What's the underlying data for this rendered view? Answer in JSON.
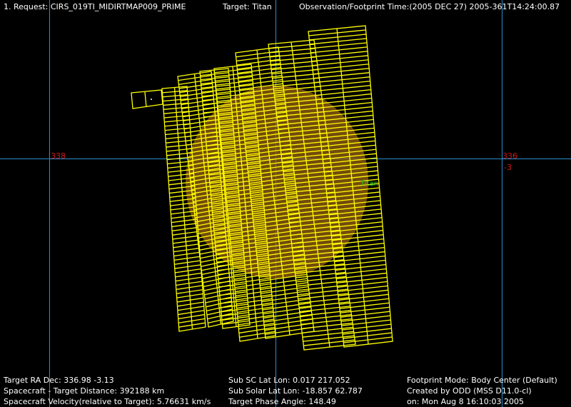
{
  "header": {
    "request": "1. Request: CIRS_019TI_MIDIRTMAP009_PRIME",
    "target": "Target: Titan",
    "observation_time": "Observation/Footprint Time:(2005 DEC 27) 2005-361T14:24:00.87"
  },
  "axis_labels": {
    "left_ra": "338",
    "right_ra": "336",
    "right_dec": "-3",
    "planet_label": "Titan"
  },
  "footer": {
    "target_ra_dec": "Target RA Dec: 336.98  -3.13",
    "distance": "Spacecraft - Target Distance:  392188 km",
    "velocity": "Spacecraft Velocity(relative to Target): 5.76631 km/s",
    "sub_sc": "Sub SC Lat Lon:  0.017  217.052",
    "sub_solar": "Sub Solar Lat Lon: -18.857  62.787",
    "phase_angle": "Target Phase Angle: 148.49",
    "footprint_mode": "Footprint Mode: Body Center (Default)",
    "created_by": "Created by ODD (MSS D11.0-cl)",
    "created_on": "on: Mon Aug  8 16:10:03 2005"
  },
  "colors": {
    "background": "#000000",
    "grid": "#2a8fd0",
    "footprint": "#ffff00",
    "tick_label": "#d01818",
    "planet": "#b07a18",
    "text": "#ffffff"
  }
}
